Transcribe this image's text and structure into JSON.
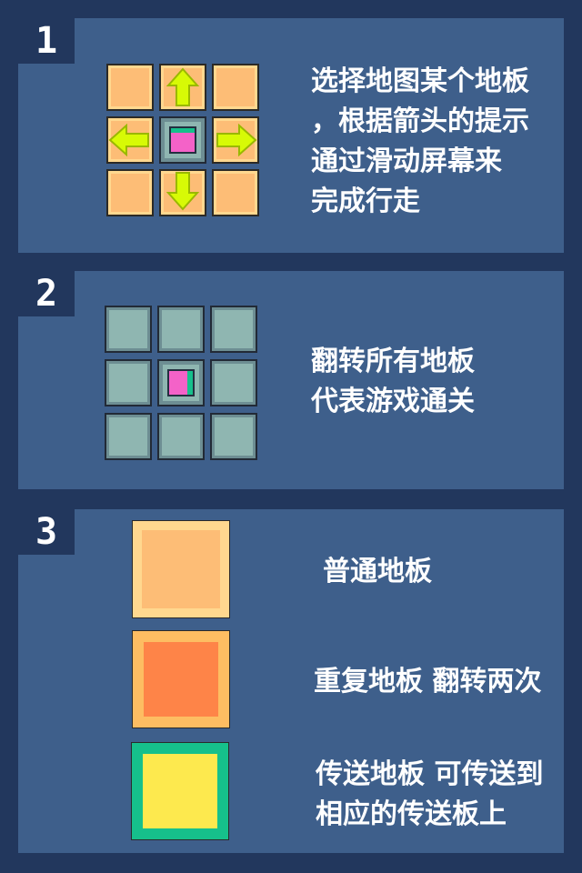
{
  "steps": [
    {
      "number": "1",
      "lines": [
        "选择地图某个地板",
        "，根据箭头的提示",
        "通过滑动屏幕来",
        "完成行走"
      ]
    },
    {
      "number": "2",
      "lines": [
        "翻转所有地板",
        "代表游戏通关"
      ]
    },
    {
      "number": "3",
      "tiles": [
        {
          "lines": [
            "普通地板"
          ]
        },
        {
          "lines": [
            "重复地板  翻转两次"
          ]
        },
        {
          "lines": [
            "传送地板  可传送到",
            "相应的传送板上"
          ]
        }
      ]
    }
  ],
  "icons": {
    "arrows": [
      "arrow-up-icon",
      "arrow-left-icon",
      "arrow-right-icon",
      "arrow-down-icon"
    ],
    "cube": "player-cube-icon"
  },
  "colors": {
    "background": "#22375d",
    "panel": "#3e5f8b",
    "normal_tile": "#fdbd76",
    "repeat_tile": "#fe8448",
    "teleport_tile": "#fde94e",
    "teleport_border": "#16c08b",
    "flipped_tile": "#8fb6b1",
    "arrow": "#d7fa06",
    "cube": "#f462c8"
  }
}
